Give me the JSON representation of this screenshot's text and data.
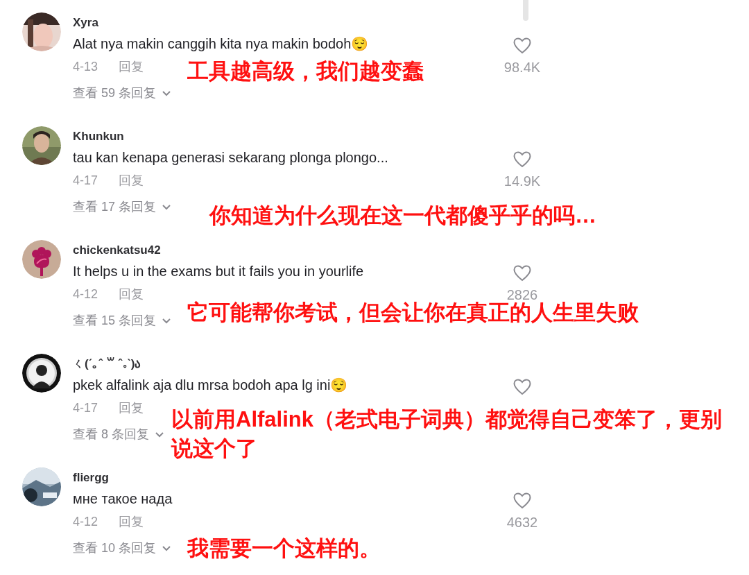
{
  "comments": [
    {
      "username": "Xyra",
      "text": "Alat nya makin canggih kita nya makin bodoh😌",
      "date": "4-13",
      "reply": "回复",
      "likes": "98.4K",
      "view_replies": "查看 59 条回复",
      "annotation": "工具越高级，我们越变蠢"
    },
    {
      "username": "Khunkun",
      "text": "tau kan kenapa generasi sekarang plonga plongo...",
      "date": "4-17",
      "reply": "回复",
      "likes": "14.9K",
      "view_replies": "查看 17 条回复",
      "annotation": "你知道为什么现在这一代都傻乎乎的吗…"
    },
    {
      "username": "chickenkatsu42",
      "text": "It helps u in the exams but it fails you in yourlife",
      "date": "4-12",
      "reply": "回复",
      "likes": "2826",
      "view_replies": "查看 15 条回复",
      "annotation": "它可能帮你考试，但会让你在真正的人生里失败"
    },
    {
      "username": "ㄑ(ˊ｡ˆ ꒳ ˆ｡ˋ)ა",
      "text": "pkek alfalink aja dlu mrsa bodoh apa lg ini😌",
      "date": "4-17",
      "reply": "回复",
      "view_replies": "查看 8 条回复",
      "annotation": "以前用Alfalink（老式电子词典）都觉得自己变笨了，更别说这个了"
    },
    {
      "username": "fliergg",
      "text": "мне такое нада",
      "date": "4-12",
      "reply": "回复",
      "likes": "4632",
      "view_replies": "查看 10 条回复",
      "annotation": "我需要一个这样的。"
    }
  ]
}
